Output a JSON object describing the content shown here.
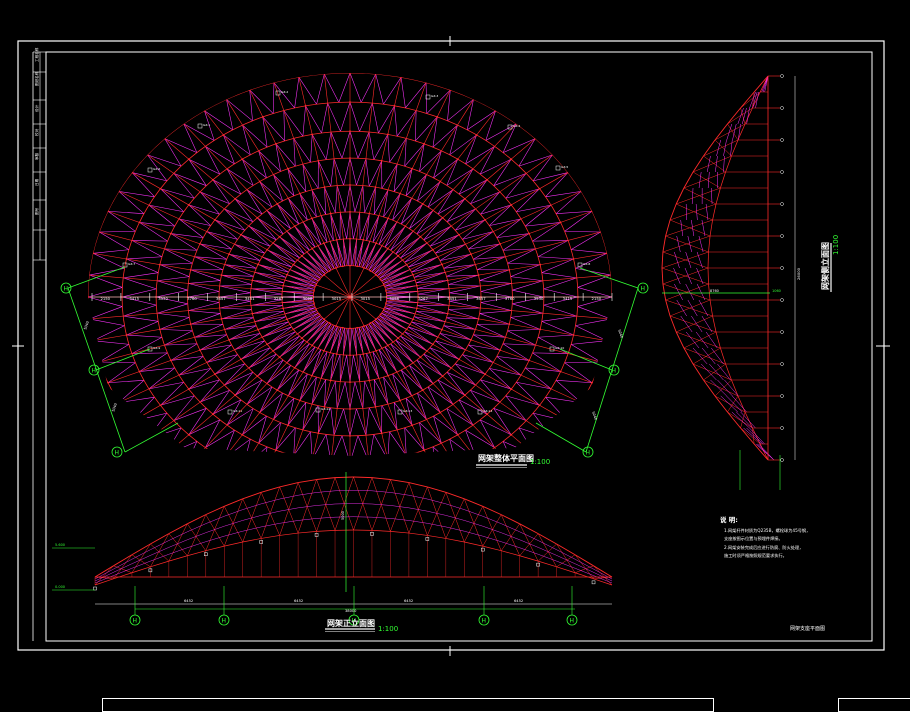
{
  "title_block": {
    "rows": [
      "工程名称",
      "图纸名称",
      "设计",
      "校对",
      "审核",
      "日期",
      "图号"
    ]
  },
  "plan": {
    "title": "网架整体平面图",
    "scale": "1:100",
    "dims": [
      "2150",
      "3415",
      "3530",
      "3760",
      "3657",
      "3451",
      "3267",
      "3098",
      "3015",
      "3015",
      "3098",
      "3267",
      "3451",
      "3657",
      "3760",
      "3530",
      "3415",
      "2150"
    ],
    "support_tags": [
      "GZ-1",
      "GZ-2",
      "GZ-3",
      "GZ-4",
      "GZ-5",
      "GZ-6",
      "GZ-7",
      "GZ-8",
      "GZ-9",
      "GZ-10",
      "GZ-11",
      "GZ-12",
      "GZ-13",
      "GZ-14"
    ],
    "axes": [
      "H",
      "H",
      "H",
      "H",
      "H",
      "H"
    ],
    "side_dims": [
      "5040",
      "5040",
      "5040",
      "5040"
    ]
  },
  "side": {
    "title": "网架侧立面图",
    "scale": "1:100",
    "dims": [
      "26000",
      "8760",
      "1060"
    ]
  },
  "front": {
    "title": "网架正立面图",
    "scale": "1:100",
    "dims": [
      "6452",
      "6452",
      "6452",
      "6452"
    ],
    "total_dim": "38000",
    "height_dim": "5000",
    "axes": [
      "H",
      "H",
      "H",
      "H",
      "H"
    ],
    "levels": [
      "5.600",
      "0.000"
    ]
  },
  "notes": {
    "heading": "说 明:",
    "lines": [
      "1.网架杆件材质为Q235B，螺栓球为45号钢，",
      "  支座按图示位置与预埋件焊接。",
      "2.网架安装完成后应进行防腐、防火处理，",
      "  施工时须严格按照规范要求执行。"
    ]
  },
  "drawing_no": "网架支座平面图",
  "colors": {
    "background": "#000000",
    "frame": "#ffffff",
    "chord": "#ff2a2a",
    "web": "#ff33ff",
    "dimension": "#33ff33",
    "text": "#ffffff"
  }
}
